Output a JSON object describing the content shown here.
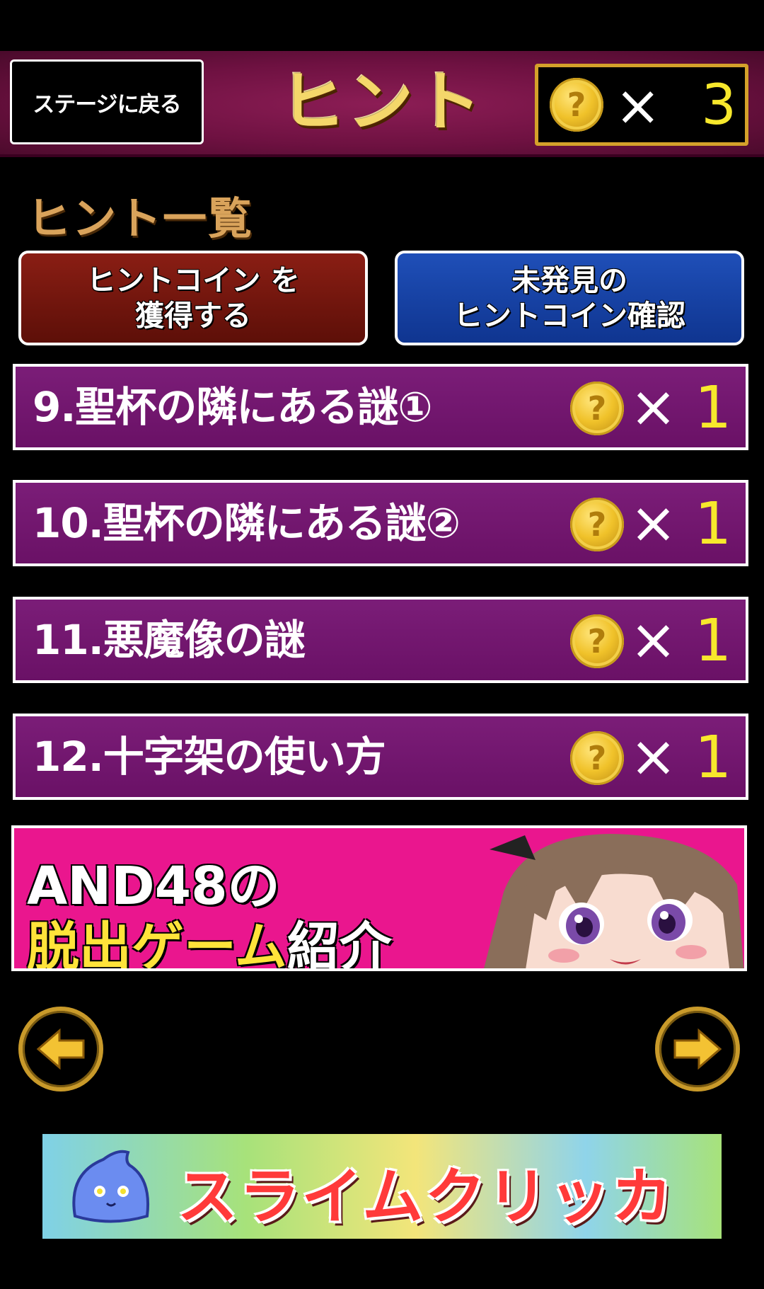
{
  "header": {
    "back_button": "ステージに戻る",
    "title": "ヒント",
    "coin_icon": "hint-coin-icon",
    "times_symbol": "×",
    "coin_count": "3"
  },
  "section": {
    "title": "ヒント一覧"
  },
  "actions": {
    "earn_coins": "ヒントコイン を\n獲得する",
    "find_coins": "未発見の\nヒントコイン確認"
  },
  "hints": [
    {
      "label": "9.聖杯の隣にある謎①",
      "cost": "1"
    },
    {
      "label": "10.聖杯の隣にある謎②",
      "cost": "1"
    },
    {
      "label": "11.悪魔像の謎",
      "cost": "1"
    },
    {
      "label": "12.十字架の使い方",
      "cost": "1"
    }
  ],
  "promo": {
    "line1": "AND48の",
    "line2_yellow": "脱出ゲーム",
    "line2_white": "紹介"
  },
  "navigation": {
    "prev_icon": "arrow-left-icon",
    "next_icon": "arrow-right-icon"
  },
  "ad": {
    "title": "スライムクリッカー"
  },
  "colors": {
    "header_bg": "#6e1141",
    "row_bg": "#6a1166",
    "coin_gold": "#f0c22a",
    "count_yellow": "#f7e82c",
    "earn_btn": "#6d140c",
    "find_btn": "#1a45a8",
    "promo_pink": "#ea168e"
  }
}
